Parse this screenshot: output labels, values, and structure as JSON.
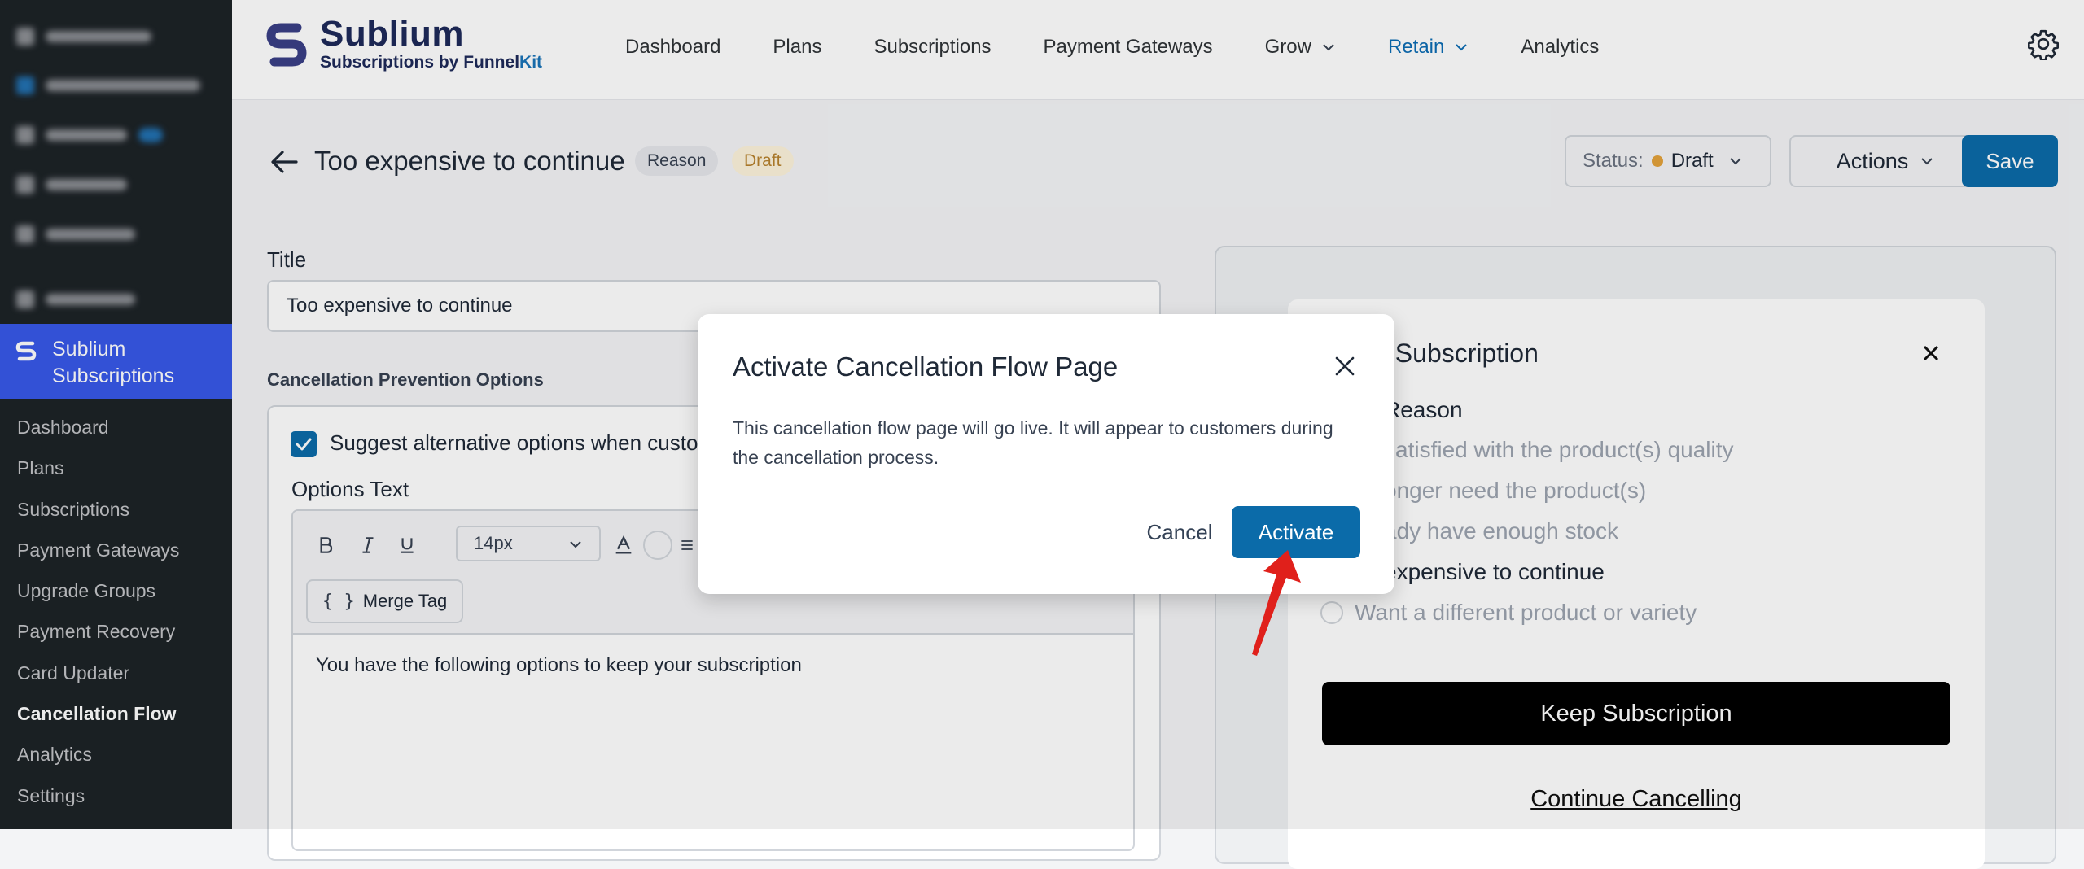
{
  "colors": {
    "primary": "#0b6ba9",
    "wp_sidebar": "#1d2327",
    "wp_active": "#3858e9",
    "draft_badge_bg": "#fdf3dc",
    "draft_badge_text": "#b7822d",
    "status_dot": "#e3a23b",
    "annotation_arrow": "#e0201b"
  },
  "wp_menu": {
    "active_plugin": "Sublium Subscriptions",
    "submenu": [
      {
        "label": "Dashboard"
      },
      {
        "label": "Plans"
      },
      {
        "label": "Subscriptions"
      },
      {
        "label": "Payment Gateways"
      },
      {
        "label": "Upgrade Groups"
      },
      {
        "label": "Payment Recovery"
      },
      {
        "label": "Card Updater"
      },
      {
        "label": "Cancellation Flow",
        "current": true
      },
      {
        "label": "Analytics"
      },
      {
        "label": "Settings"
      }
    ]
  },
  "brand": {
    "title": "Sublium",
    "subtitle_prefix": "Subscriptions by ",
    "subtitle_brand_a": "Funnel",
    "subtitle_brand_b": "Kit"
  },
  "nav": {
    "items": [
      {
        "label": "Dashboard",
        "icon": null
      },
      {
        "label": "Plans",
        "icon": null
      },
      {
        "label": "Subscriptions",
        "icon": null
      },
      {
        "label": "Payment Gateways",
        "icon": null
      },
      {
        "label": "Grow",
        "icon": "chevron-down-icon"
      },
      {
        "label": "Retain",
        "icon": "chevron-down-icon",
        "active": true
      },
      {
        "label": "Analytics",
        "icon": null
      }
    ],
    "settings_icon": "gear-icon"
  },
  "page": {
    "title": "Too expensive to continue",
    "tag_reason": "Reason",
    "tag_draft": "Draft",
    "status_label": "Status:",
    "status_value": "Draft",
    "actions_label": "Actions",
    "save_label": "Save"
  },
  "form": {
    "title_label": "Title",
    "title_value": "Too expensive to continue",
    "section_label": "Cancellation Prevention Options",
    "checkbox_label": "Suggest alternative options when custo",
    "checkbox_checked": true,
    "options_text_label": "Options Text",
    "font_size": "14px",
    "merge_tag_label": "Merge Tag",
    "editor_content": "You have the following options to keep your subscription"
  },
  "preview": {
    "title_fragment": "el Subscription",
    "reason_fragment": "Reason",
    "options": [
      {
        "text": "satisfied with the product(s) quality",
        "selected": false
      },
      {
        "text": "onger need the product(s)",
        "selected": false
      },
      {
        "text": "ady have enough stock",
        "selected": false
      },
      {
        "text": "expensive to continue",
        "selected": true
      },
      {
        "text": "Want a different product or variety",
        "selected": false
      }
    ],
    "keep_label": "Keep Subscription",
    "continue_label": "Continue Cancelling"
  },
  "modal": {
    "title": "Activate Cancellation Flow Page",
    "body": "This cancellation flow page will go live. It will appear to customers during the cancellation process.",
    "cancel_label": "Cancel",
    "activate_label": "Activate"
  }
}
